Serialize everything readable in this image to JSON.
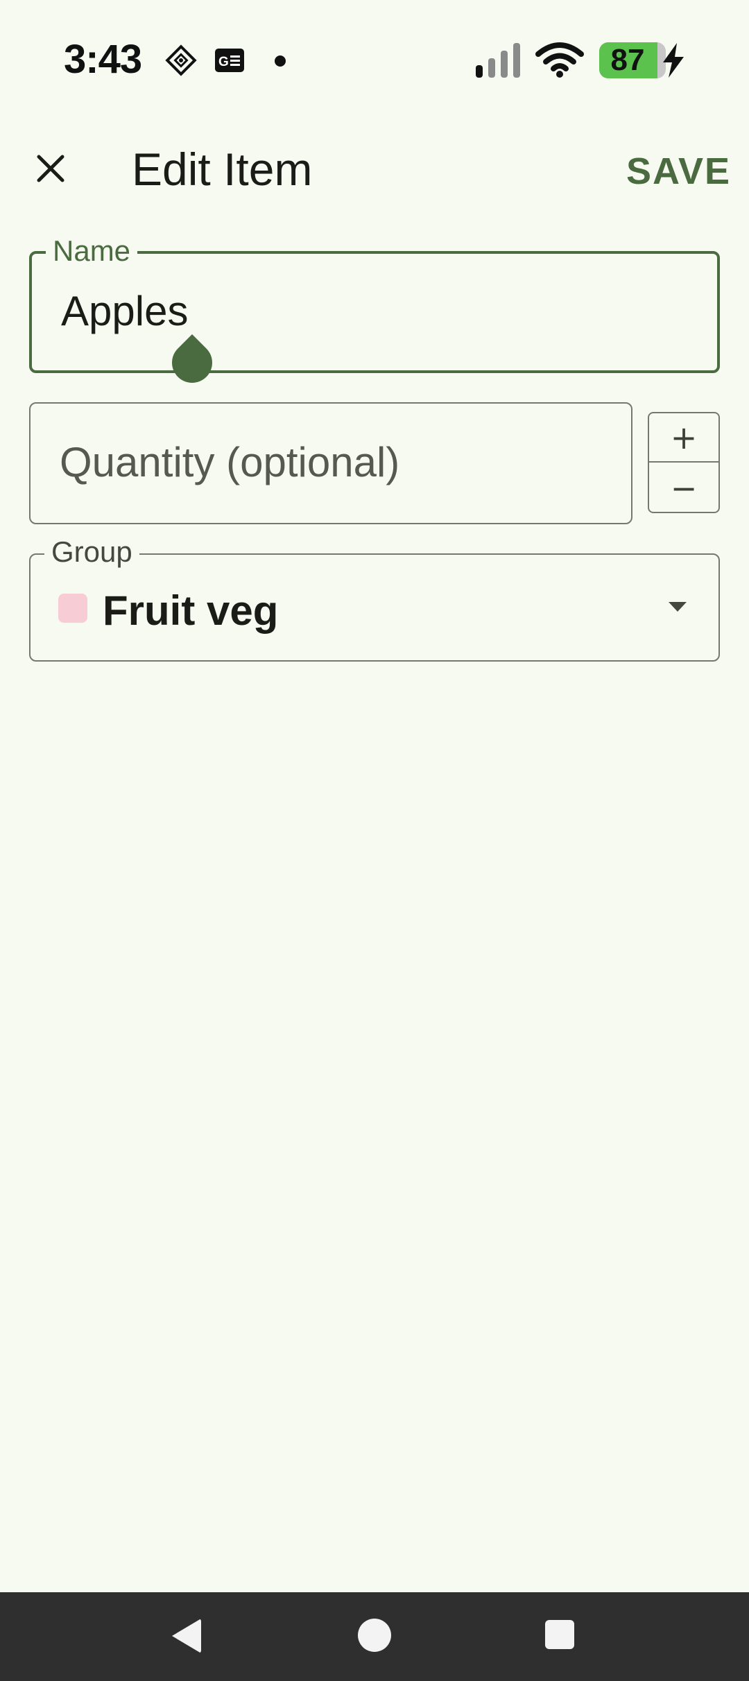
{
  "status_bar": {
    "time": "3:43",
    "battery_level": "87",
    "battery_fraction": 0.87,
    "icons": [
      "navigation-diamond-icon",
      "news-icon",
      "notification-dot-icon",
      "signal-icon",
      "wifi-icon",
      "battery-icon",
      "charging-bolt-icon"
    ]
  },
  "app_bar": {
    "close_icon": "close-icon",
    "title": "Edit Item",
    "save_label": "SAVE"
  },
  "form": {
    "name": {
      "label": "Name",
      "value": "Apples"
    },
    "quantity": {
      "placeholder": "Quantity (optional)",
      "value": ""
    },
    "stepper": {
      "plus": "+",
      "minus": "−"
    },
    "group": {
      "label": "Group",
      "value": "Fruit veg",
      "swatch_color": "#f8ccd4"
    }
  },
  "colors": {
    "accent": "#4a6b3f",
    "background": "#f7faf1",
    "nav_bar": "#2f2f2f"
  },
  "nav_bar": {
    "icons": [
      "back-icon",
      "home-icon",
      "recents-icon"
    ]
  }
}
